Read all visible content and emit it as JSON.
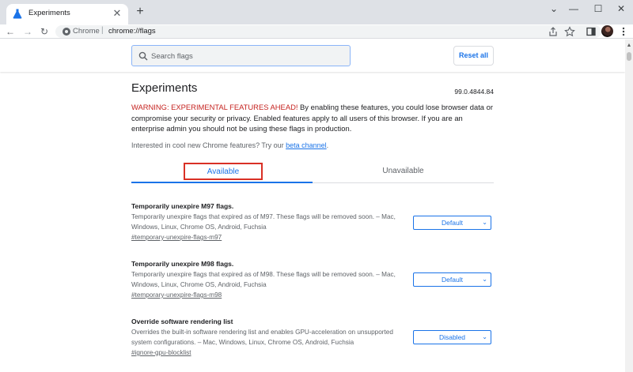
{
  "browser": {
    "tab_title": "Experiments",
    "tab_close": "✕",
    "new_tab": "+",
    "window": {
      "minimize": "—",
      "maximize": "☐",
      "close": "✕",
      "menu": "⌄"
    }
  },
  "toolbar": {
    "back": "←",
    "forward": "→",
    "reload": "↻",
    "site_label": "Chrome",
    "separator": "|",
    "url": "chrome://flags",
    "icons": [
      "share-icon",
      "bookmark-star-icon",
      "side-panel-icon",
      "profile-avatar",
      "menu-kebab-icon"
    ]
  },
  "header": {
    "search_placeholder": "Search flags",
    "reset_label": "Reset all"
  },
  "page": {
    "title": "Experiments",
    "version": "99.0.4844.84",
    "warning_strong": "WARNING: EXPERIMENTAL FEATURES AHEAD!",
    "warning_body": " By enabling these features, you could lose browser data or compromise your security or privacy. Enabled features apply to all users of this browser. If you are an enterprise admin you should not be using these flags in production.",
    "interest_text": "Interested in cool new Chrome features? Try our ",
    "interest_link": "beta channel",
    "interest_end": "."
  },
  "tabs": {
    "available": "Available",
    "unavailable": "Unavailable"
  },
  "flags": [
    {
      "name": "Temporarily unexpire M97 flags.",
      "description": "Temporarily unexpire flags that expired as of M97. These flags will be removed soon. – Mac, Windows, Linux, Chrome OS, Android, Fuchsia",
      "link": "#temporary-unexpire-flags-m97",
      "value": "Default"
    },
    {
      "name": "Temporarily unexpire M98 flags.",
      "description": "Temporarily unexpire flags that expired as of M98. These flags will be removed soon. – Mac, Windows, Linux, Chrome OS, Android, Fuchsia",
      "link": "#temporary-unexpire-flags-m98",
      "value": "Default"
    },
    {
      "name": "Override software rendering list",
      "description": "Overrides the built-in software rendering list and enables GPU-acceleration on unsupported system configurations. – Mac, Windows, Linux, Chrome OS, Android, Fuchsia",
      "link": "#ignore-gpu-blocklist",
      "value": "Disabled"
    }
  ],
  "colors": {
    "accent": "#1a73e8",
    "warning_red": "#c5221f",
    "highlight_box": "#d93025"
  }
}
